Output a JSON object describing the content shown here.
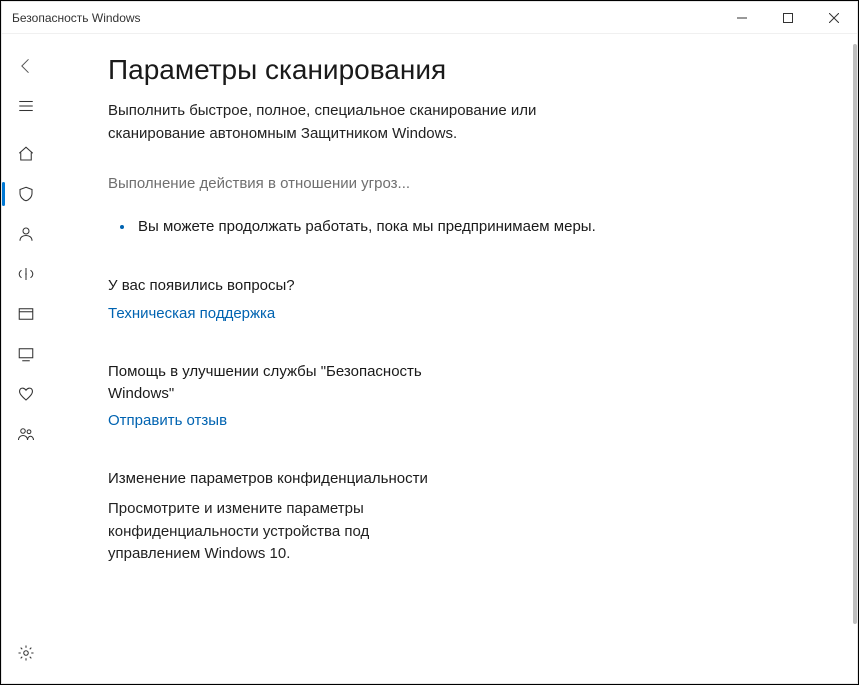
{
  "titlebar": {
    "title": "Безопасность Windows"
  },
  "page": {
    "heading": "Параметры сканирования",
    "description": "Выполнить быстрое, полное, специальное сканирование или сканирование автономным Защитником Windows."
  },
  "status": {
    "heading": "Выполнение действия в отношении угроз...",
    "message": "Вы можете продолжать работать, пока мы предпринимаем меры."
  },
  "sections": {
    "questions": {
      "title": "У вас появились вопросы?",
      "link": "Техническая поддержка"
    },
    "improve": {
      "title": "Помощь в улучшении службы \"Безопасность Windows\"",
      "link": "Отправить отзыв"
    },
    "privacy": {
      "title": "Изменение параметров конфиденциальности",
      "desc": "Просмотрите и измените параметры конфиденциальности устройства под управлением Windows 10."
    }
  },
  "nav": {
    "back": "back",
    "menu": "menu",
    "home": "home",
    "shield": "virus-protection",
    "account": "account-protection",
    "firewall": "firewall",
    "appbrowser": "app-browser-control",
    "device": "device-security",
    "health": "device-performance",
    "family": "family-options",
    "settings": "settings"
  }
}
